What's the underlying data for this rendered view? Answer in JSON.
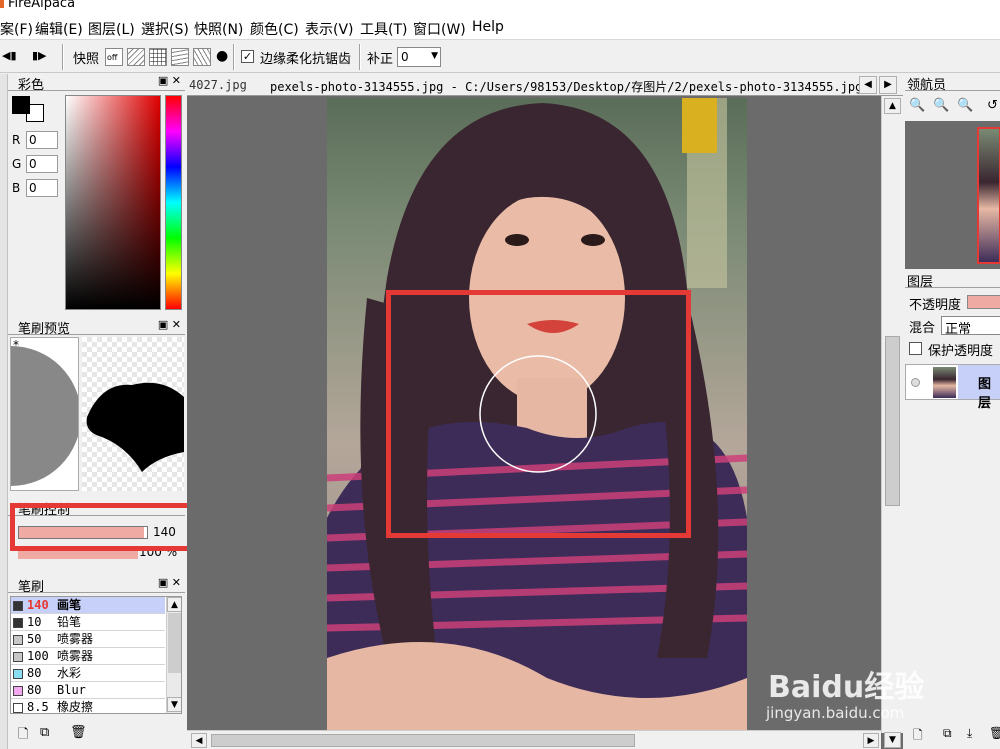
{
  "app_title": "FireAlpaca",
  "menu": [
    "案(F)",
    "编辑(E)",
    "图层(L)",
    "選択(S)",
    "快照(N)",
    "颜色(C)",
    "表示(V)",
    "工具(T)",
    "窗口(W)",
    "Help"
  ],
  "toolbar": {
    "snap_label": "快照",
    "off_label": "off",
    "antialias_label": "边缘柔化抗锯齿",
    "correction_label": "补正",
    "correction_value": "0"
  },
  "color_panel": {
    "title": "彩色",
    "r_label": "R",
    "r_value": "0",
    "g_label": "G",
    "g_value": "0",
    "b_label": "B",
    "b_value": "0",
    "fg_color": "#000000"
  },
  "brush_preview": {
    "title": "笔刷预览",
    "marker": "*"
  },
  "brush_control": {
    "title": "笔刷控制",
    "size_value": "140",
    "size_fraction": 0.98,
    "opacity_value": "100 %",
    "bar_color": "#f0aaa4"
  },
  "brush_list": {
    "title": "笔刷",
    "items": [
      {
        "size": "140",
        "name": "画笔",
        "selected": true,
        "swatch": "#333333"
      },
      {
        "size": "10",
        "name": "铅笔",
        "selected": false,
        "swatch": "#333333"
      },
      {
        "size": "50",
        "name": "喷雾器",
        "selected": false,
        "swatch": "#c8c8c8"
      },
      {
        "size": "100",
        "name": "喷雾器",
        "selected": false,
        "swatch": "#c8c8c8"
      },
      {
        "size": "80",
        "name": "水彩",
        "selected": false,
        "swatch": "#88ddf0"
      },
      {
        "size": "80",
        "name": "Blur",
        "selected": false,
        "swatch": "#f4a8f0"
      },
      {
        "size": "8.5",
        "name": "橡皮擦",
        "selected": false,
        "swatch": "#ffffff"
      }
    ]
  },
  "document": {
    "tab_prev": "4027.jpg",
    "tab_title": "pexels-photo-3134555.jpg - C:/Users/98153/Desktop/存图片/2/pexels-photo-3134555.jpg"
  },
  "navigator": {
    "title": "领航员"
  },
  "layers": {
    "title": "图层",
    "opacity_label": "不透明度",
    "blend_label": "混合",
    "blend_value": "正常",
    "protect_label": "保护透明度",
    "layer_name": "图层"
  },
  "watermark": {
    "brand": "Baidu经验",
    "url": "jingyan.baidu.com"
  },
  "annotation_color": "#e53935"
}
